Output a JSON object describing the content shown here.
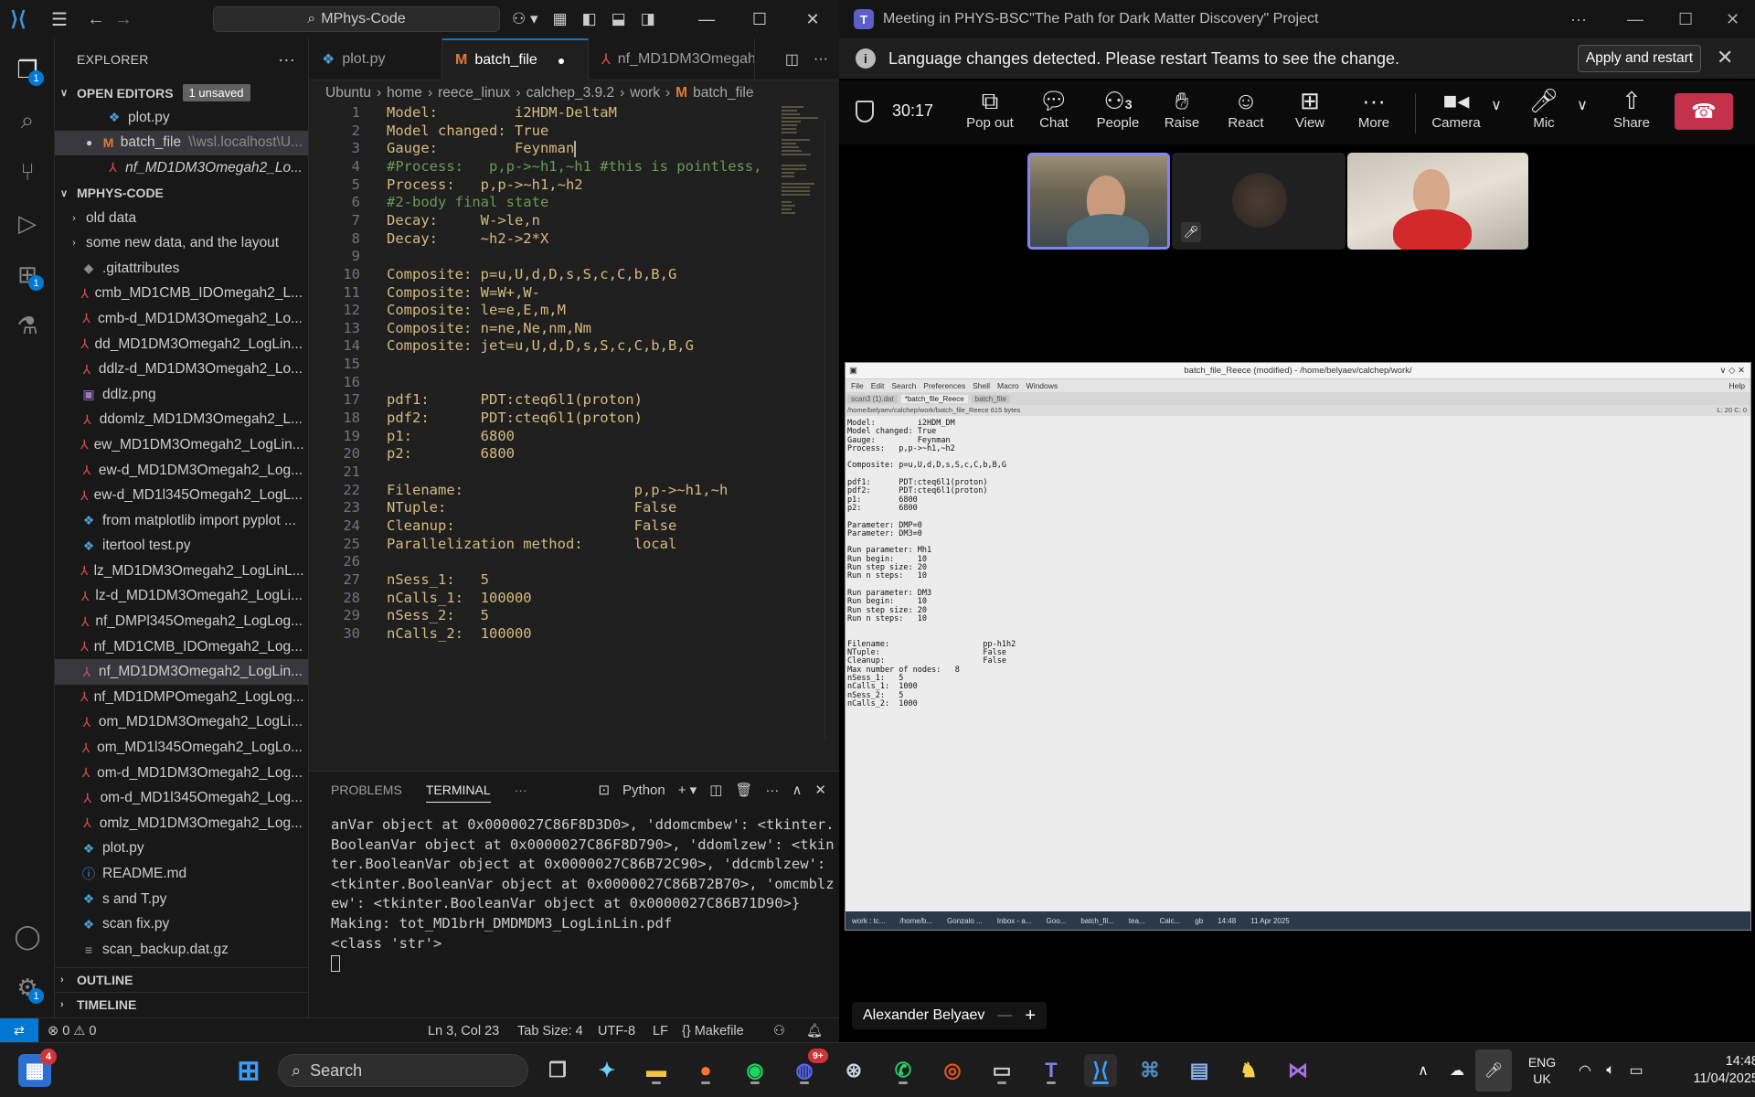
{
  "vscode": {
    "search": "MPhys-Code",
    "sidebar": {
      "title": "EXPLORER",
      "open_editors_label": "OPEN EDITORS",
      "unsaved_badge": "1 unsaved",
      "open_editors": [
        {
          "name": "plot.py",
          "sub": ""
        },
        {
          "name": "batch_file",
          "sub": "\\\\wsl.localhost\\U..."
        },
        {
          "name": "nf_MD1DM3Omegah2_Lo...",
          "sub": ""
        }
      ],
      "project_label": "MPHYS-CODE",
      "files": [
        "old data",
        "some new data, and the layout",
        ".gitattributes",
        "cmb_MD1CMB_IDOmegah2_L...",
        "cmb-d_MD1DM3Omegah2_Lo...",
        "dd_MD1DM3Omegah2_LogLin...",
        "ddlz-d_MD1DM3Omegah2_Lo...",
        "ddlz.png",
        "ddomlz_MD1DM3Omegah2_L...",
        "ew_MD1DM3Omegah2_LogLin...",
        "ew-d_MD1DM3Omegah2_Log...",
        "ew-d_MD1l345Omegah2_LogL...",
        "from matplotlib import pyplot ...",
        "itertool test.py",
        "lz_MD1DM3Omegah2_LogLinL...",
        "lz-d_MD1DM3Omegah2_LogLi...",
        "nf_DMPl345Omegah2_LogLog...",
        "nf_MD1CMB_IDOmegah2_Log...",
        "nf_MD1DM3Omegah2_LogLin...",
        "nf_MD1DMPOmegah2_LogLog...",
        "om_MD1DM3Omegah2_LogLi...",
        "om_MD1l345Omegah2_LogLo...",
        "om-d_MD1DM3Omegah2_Log...",
        "om-d_MD1l345Omegah2_Log...",
        "omlz_MD1DM3Omegah2_Log...",
        "plot.py",
        "README.md",
        "s and T.py",
        "scan fix.py",
        "scan_backup.dat.gz"
      ],
      "outline_label": "OUTLINE",
      "timeline_label": "TIMELINE"
    },
    "tabs": [
      "plot.py",
      "batch_file",
      "nf_MD1DM3Omegah2_"
    ],
    "breadcrumbs": [
      "Ubuntu",
      "home",
      "reece_linux",
      "calchep_3.9.2",
      "work",
      "batch_file"
    ],
    "code": [
      "Model:         i2HDM-DeltaM",
      "Model changed: True",
      "Gauge:         Feynman",
      "#Process:   p,p->~h1,~h1 #this is pointless,",
      "Process:   p,p->~h1,~h2",
      "#2-body final state",
      "Decay:     W->le,n",
      "Decay:     ~h2->2*X",
      "",
      "Composite: p=u,U,d,D,s,S,c,C,b,B,G",
      "Composite: W=W+,W-",
      "Composite: le=e,E,m,M",
      "Composite: n=ne,Ne,nm,Nm",
      "Composite: jet=u,U,d,D,s,S,c,C,b,B,G",
      "",
      "",
      "pdf1:      PDT:cteq6l1(proton)",
      "pdf2:      PDT:cteq6l1(proton)",
      "p1:        6800",
      "p2:        6800",
      "",
      "Filename:                    p,p->~h1,~h",
      "NTuple:                      False",
      "Cleanup:                     False",
      "Parallelization method:      local",
      "",
      "nSess_1:   5",
      "nCalls_1:  100000",
      "nSess_2:   5",
      "nCalls_2:  100000"
    ],
    "panel": {
      "tabs": [
        "PROBLEMS",
        "TERMINAL"
      ],
      "terminal_profile": "Python",
      "terminal_lines": [
        "anVar object at 0x0000027C86F8D3D0>, 'ddomcmbew': <tkinter.",
        "BooleanVar object at 0x0000027C86F8D790>, 'ddomlzew': <tkin",
        "ter.BooleanVar object at 0x0000027C86B72C90>, 'ddcmblzew':",
        "<tkinter.BooleanVar object at 0x0000027C86B72B70>, 'omcmblz",
        "ew': <tkinter.BooleanVar object at 0x0000027C86B71D90>}",
        "Making: tot_MD1brH_DMDMDM3_LogLinLin.pdf",
        "<class 'str'>"
      ]
    },
    "status": {
      "errors": "0",
      "warnings": "0",
      "position": "Ln 3, Col 23",
      "tab_size": "Tab Size: 4",
      "encoding": "UTF-8",
      "eol": "LF",
      "language": "Makefile"
    }
  },
  "teams": {
    "title": "Meeting in PHYS-BSC\"The Path for Dark Matter Discovery\" Project",
    "banner": "Language changes detected. Please restart Teams to see the change.",
    "banner_button": "Apply and restart",
    "timer": "30:17",
    "people_count": "3",
    "buttons": [
      "Pop out",
      "Chat",
      "People",
      "Raise",
      "React",
      "View",
      "More",
      "Camera",
      "Mic",
      "Share"
    ],
    "participant_name": "Alexander Belyaev",
    "shared": {
      "title": "batch_file_Reece (modified) - /home/belyaev/calchep/work/",
      "menu": [
        "File",
        "Edit",
        "Search",
        "Preferences",
        "Shell",
        "Macro",
        "Windows"
      ],
      "help": "Help",
      "tabs": [
        "scan3 (1).dat",
        "*batch_file_Reece",
        "batch_file"
      ],
      "path": "/home/belyaev/calchep/work/batch_file_Reece 615 bytes",
      "position": "L: 20  C: 0",
      "text": "Model:         i2HDM_DM\nModel changed: True\nGauge:         Feynman\nProcess:   p,p->~h1,~h2\n\nComposite: p=u,U,d,D,s,S,c,C,b,B,G\n\npdf1:      PDT:cteq6l1(proton)\npdf2:      PDT:cteq6l1(proton)\np1:        6800\np2:        6800\n\nParameter: DMP=0\nParameter: DM3=0\n\nRun parameter: Mh1\nRun begin:     10\nRun step size: 20\nRun n steps:   10\n\nRun parameter: DM3\nRun begin:     10\nRun step size: 20\nRun n steps:   10\n\n\nFilename:                    pp-h1h2\nNTuple:                      False\nCleanup:                     False\nMax number of nodes:   8\nnSess_1:   5\nnCalls_1:  1000\nnSess_2:   5\nnCalls_2:  1000",
      "taskbar": [
        "work : tc...",
        "/home/b...",
        "Gonzalo ...",
        "Inbox - a...",
        "Goo...",
        "batch_fil...",
        "tea...",
        "Calc...",
        "gb",
        "14:48",
        "11 Apr 2025"
      ]
    }
  },
  "taskbar": {
    "search": "Search",
    "notification_badge": "4",
    "discord_badge": "9+",
    "lang_top": "ENG",
    "lang_bottom": "UK",
    "time": "14:48",
    "date": "11/04/2025"
  }
}
